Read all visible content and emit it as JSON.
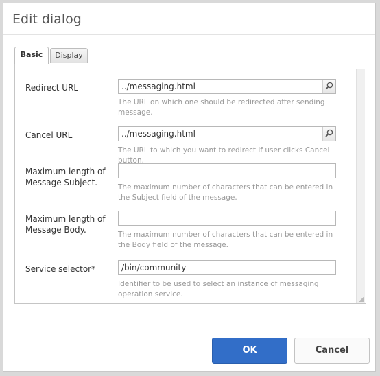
{
  "dialog": {
    "title": "Edit dialog"
  },
  "tabs": [
    {
      "label": "Basic",
      "active": true
    },
    {
      "label": "Display",
      "active": false
    }
  ],
  "fields": {
    "redirect_url": {
      "label": "Redirect URL",
      "value": "../messaging.html",
      "help": "The URL on which one should be redirected after sending message."
    },
    "cancel_url": {
      "label": "Cancel URL",
      "value": "../messaging.html",
      "help": "The URL to which you want to redirect if user clicks Cancel button."
    },
    "max_subject": {
      "label_line1": "Maximum length of",
      "label_line2": "Message Subject.",
      "value": "",
      "help": "The maximum number of characters that can be entered in the Subject field of the message."
    },
    "max_body": {
      "label_line1": "Maximum length of",
      "label_line2": "Message Body.",
      "value": "",
      "help": "The maximum number of characters that can be entered in the Body field of the message."
    },
    "service_selector": {
      "label": "Service selector*",
      "value": "/bin/community",
      "help": "Identifier to be used to select an instance of messaging operation service."
    }
  },
  "buttons": {
    "ok": "OK",
    "cancel": "Cancel"
  },
  "colors": {
    "primary": "#326ec8",
    "help_text": "#999999"
  }
}
